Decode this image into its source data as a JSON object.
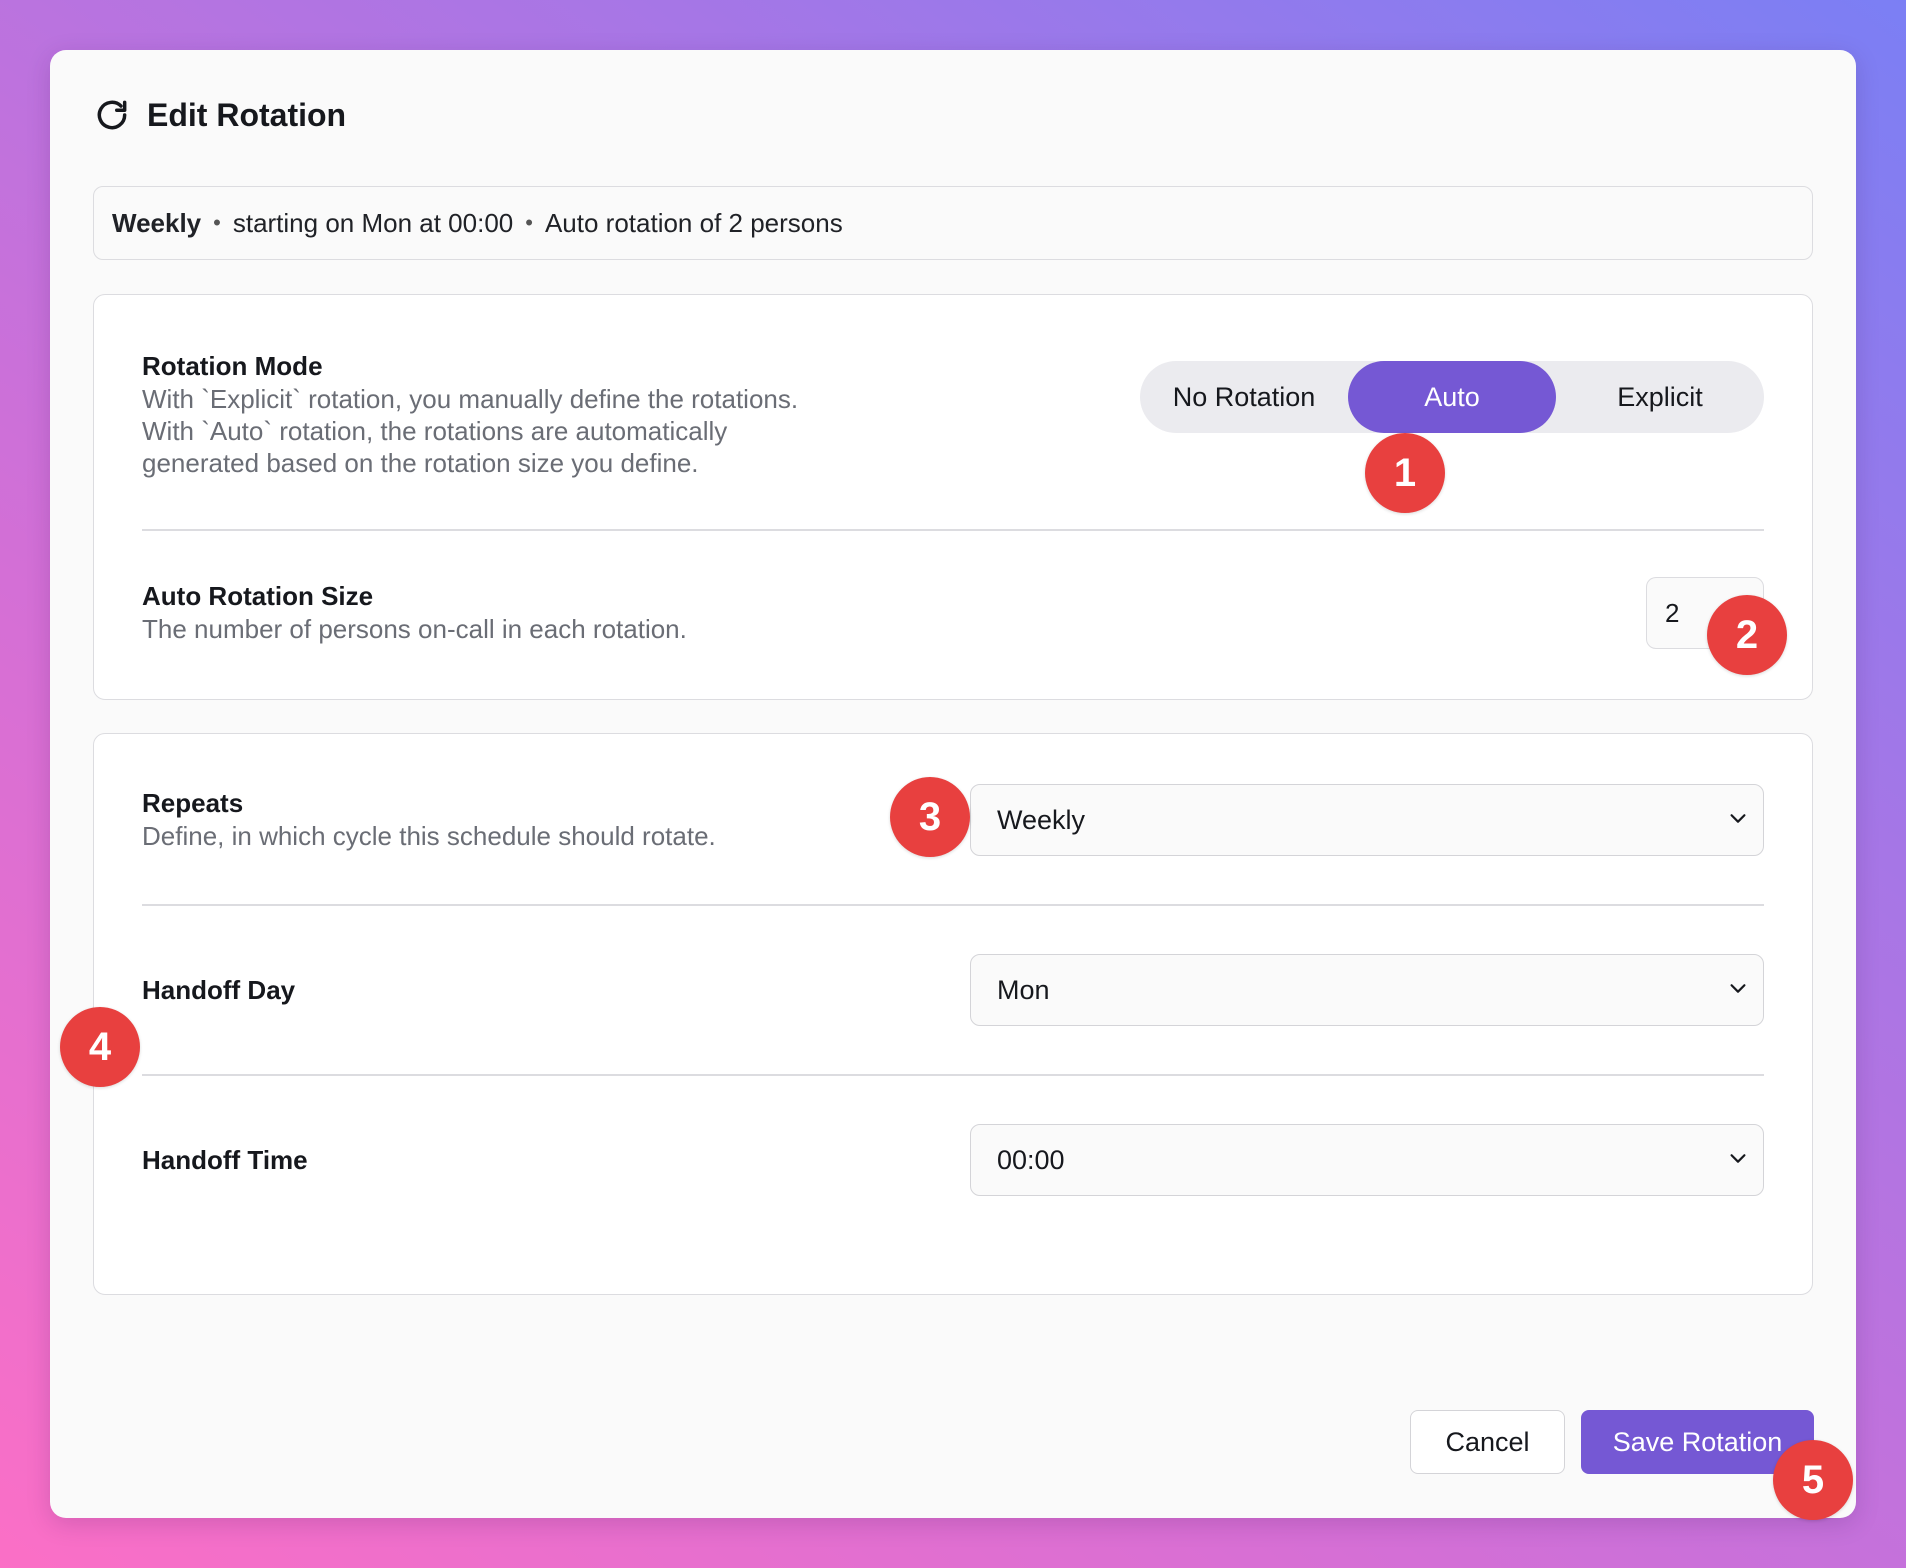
{
  "dialog": {
    "title": "Edit Rotation",
    "title_icon": "refresh-icon"
  },
  "summary": {
    "frequency": "Weekly",
    "start": "starting on Mon at 00:00",
    "rotation": "Auto rotation of 2 persons",
    "separator": "•"
  },
  "rotation_mode": {
    "label": "Rotation Mode",
    "description": "With `Explicit` rotation, you manually define the rotations. With `Auto` rotation, the rotations are automatically generated based on the rotation size you define.",
    "options": [
      "No Rotation",
      "Auto",
      "Explicit"
    ],
    "selected": "Auto"
  },
  "auto_rotation_size": {
    "label": "Auto Rotation Size",
    "description": "The number of persons on-call in each rotation.",
    "value": "2"
  },
  "repeats": {
    "label": "Repeats",
    "description": "Define, in which cycle this schedule should rotate.",
    "value": "Weekly"
  },
  "handoff_day": {
    "label": "Handoff Day",
    "value": "Mon"
  },
  "handoff_time": {
    "label": "Handoff Time",
    "value": "00:00"
  },
  "footer": {
    "cancel_label": "Cancel",
    "save_label": "Save Rotation"
  },
  "annotations": [
    "1",
    "2",
    "3",
    "4",
    "5"
  ],
  "colors": {
    "accent": "#7558d4",
    "marker": "#e8403f"
  }
}
